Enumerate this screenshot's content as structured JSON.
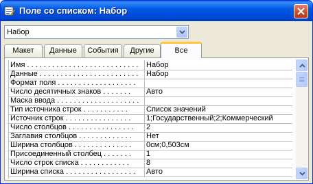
{
  "window": {
    "title": "Поле со списком: Набор",
    "app_icon": "form-properties-icon",
    "close_icon": "close-icon"
  },
  "object_selector": {
    "value": "Набор",
    "icon": "chevron-down-icon"
  },
  "tabs": [
    {
      "label": "Макет",
      "active": false
    },
    {
      "label": "Данные",
      "active": false
    },
    {
      "label": "События",
      "active": false
    },
    {
      "label": "Другие",
      "active": false
    },
    {
      "label": "Все",
      "active": true
    }
  ],
  "properties": [
    {
      "label": "Имя . . . . . . . . . . . . . . . . . . . . . . . . . . .",
      "value": "Набор"
    },
    {
      "label": "Данные . . . . . . . . . . . . . . . . . . . . . . . .",
      "value": "Набор"
    },
    {
      "label": "Формат поля . . . . . . . . . . . . . . . . . . .",
      "value": ""
    },
    {
      "label": "Число десятичных знаков . . . . . . .",
      "value": "Авто"
    },
    {
      "label": "Маска ввода . . . . . . . . . . . . . . . . . . . .",
      "value": ""
    },
    {
      "label": "Тип источника строк . . . . . . . . . . .",
      "value": "Список значений"
    },
    {
      "label": "Источник строк . . . . . . . . . . . . . . . .",
      "value": "1;Государственный;2;Коммерческий"
    },
    {
      "label": "Число столбцов . . . . . . . . . . . . . . . .",
      "value": "2"
    },
    {
      "label": "Заглавия столбцов . . . . . . . . . . . . .",
      "value": "Нет"
    },
    {
      "label": "Ширина столбцов . . . . . . . . . . . . . .",
      "value": "0см;0,503см"
    },
    {
      "label": "Присоединенный столбец . . . . . . .",
      "value": "1"
    },
    {
      "label": "Число строк списка . . . . . . . . . . . .",
      "value": "8"
    },
    {
      "label": "Ширина списка . . . . . . . . . . . . . . . . .",
      "value": "Авто"
    }
  ],
  "scrollbar": {
    "up_icon": "scroll-up-arrow-icon",
    "down_icon": "scroll-down-arrow-icon"
  }
}
